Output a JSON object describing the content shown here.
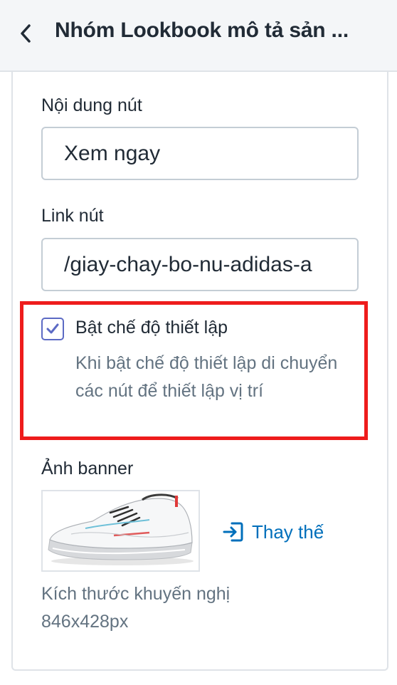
{
  "header": {
    "title": "Nhóm Lookbook mô tả sản ...",
    "back_icon": "chevron-left-icon"
  },
  "button_text_field": {
    "label": "Nội dung nút",
    "value": "Xem ngay"
  },
  "button_link_field": {
    "label": "Link nút",
    "value": "/giay-chay-bo-nu-adidas-a"
  },
  "setup_mode": {
    "checked": true,
    "label": "Bật chế độ thiết lập",
    "help": "Khi bật chế độ thiết lập di chuyển các nút để thiết lập vị trí"
  },
  "banner": {
    "label": "Ảnh banner",
    "replace_label": "Thay thế",
    "replace_icon": "import-icon",
    "size_hint": "Kích thước khuyến nghị 846x428px"
  },
  "colors": {
    "accent": "#5c6ac4",
    "link": "#006fbb",
    "highlight": "#ee1c1c",
    "subdued": "#637381"
  }
}
